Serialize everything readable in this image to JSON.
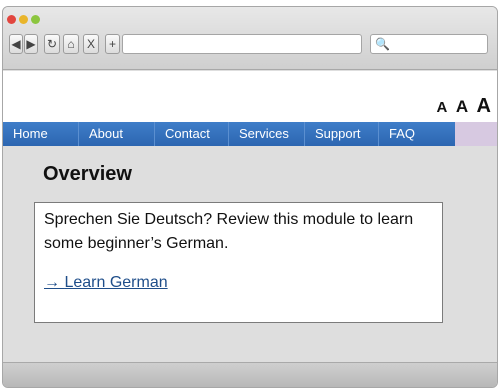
{
  "browser": {
    "nav_buttons": [
      {
        "label": "◀",
        "name": "back-button"
      },
      {
        "label": "▶",
        "name": "forward-button"
      },
      {
        "label": "↻",
        "name": "reload-button"
      },
      {
        "label": "⌂",
        "name": "home-button"
      },
      {
        "label": "X",
        "name": "stop-button"
      },
      {
        "label": "+",
        "name": "new-tab-button"
      }
    ],
    "search_icon": "🔍"
  },
  "site": {
    "font_size_controls": [
      "A",
      "A",
      "A"
    ],
    "nav": [
      "Home",
      "About",
      "Contact",
      "Services",
      "Support",
      "FAQ"
    ],
    "page_title": "Overview",
    "description": "Sprechen Sie Deutsch? Review this module to learn some beginner’s German.",
    "link": {
      "arrow": "→",
      "label": "Learn German"
    }
  }
}
